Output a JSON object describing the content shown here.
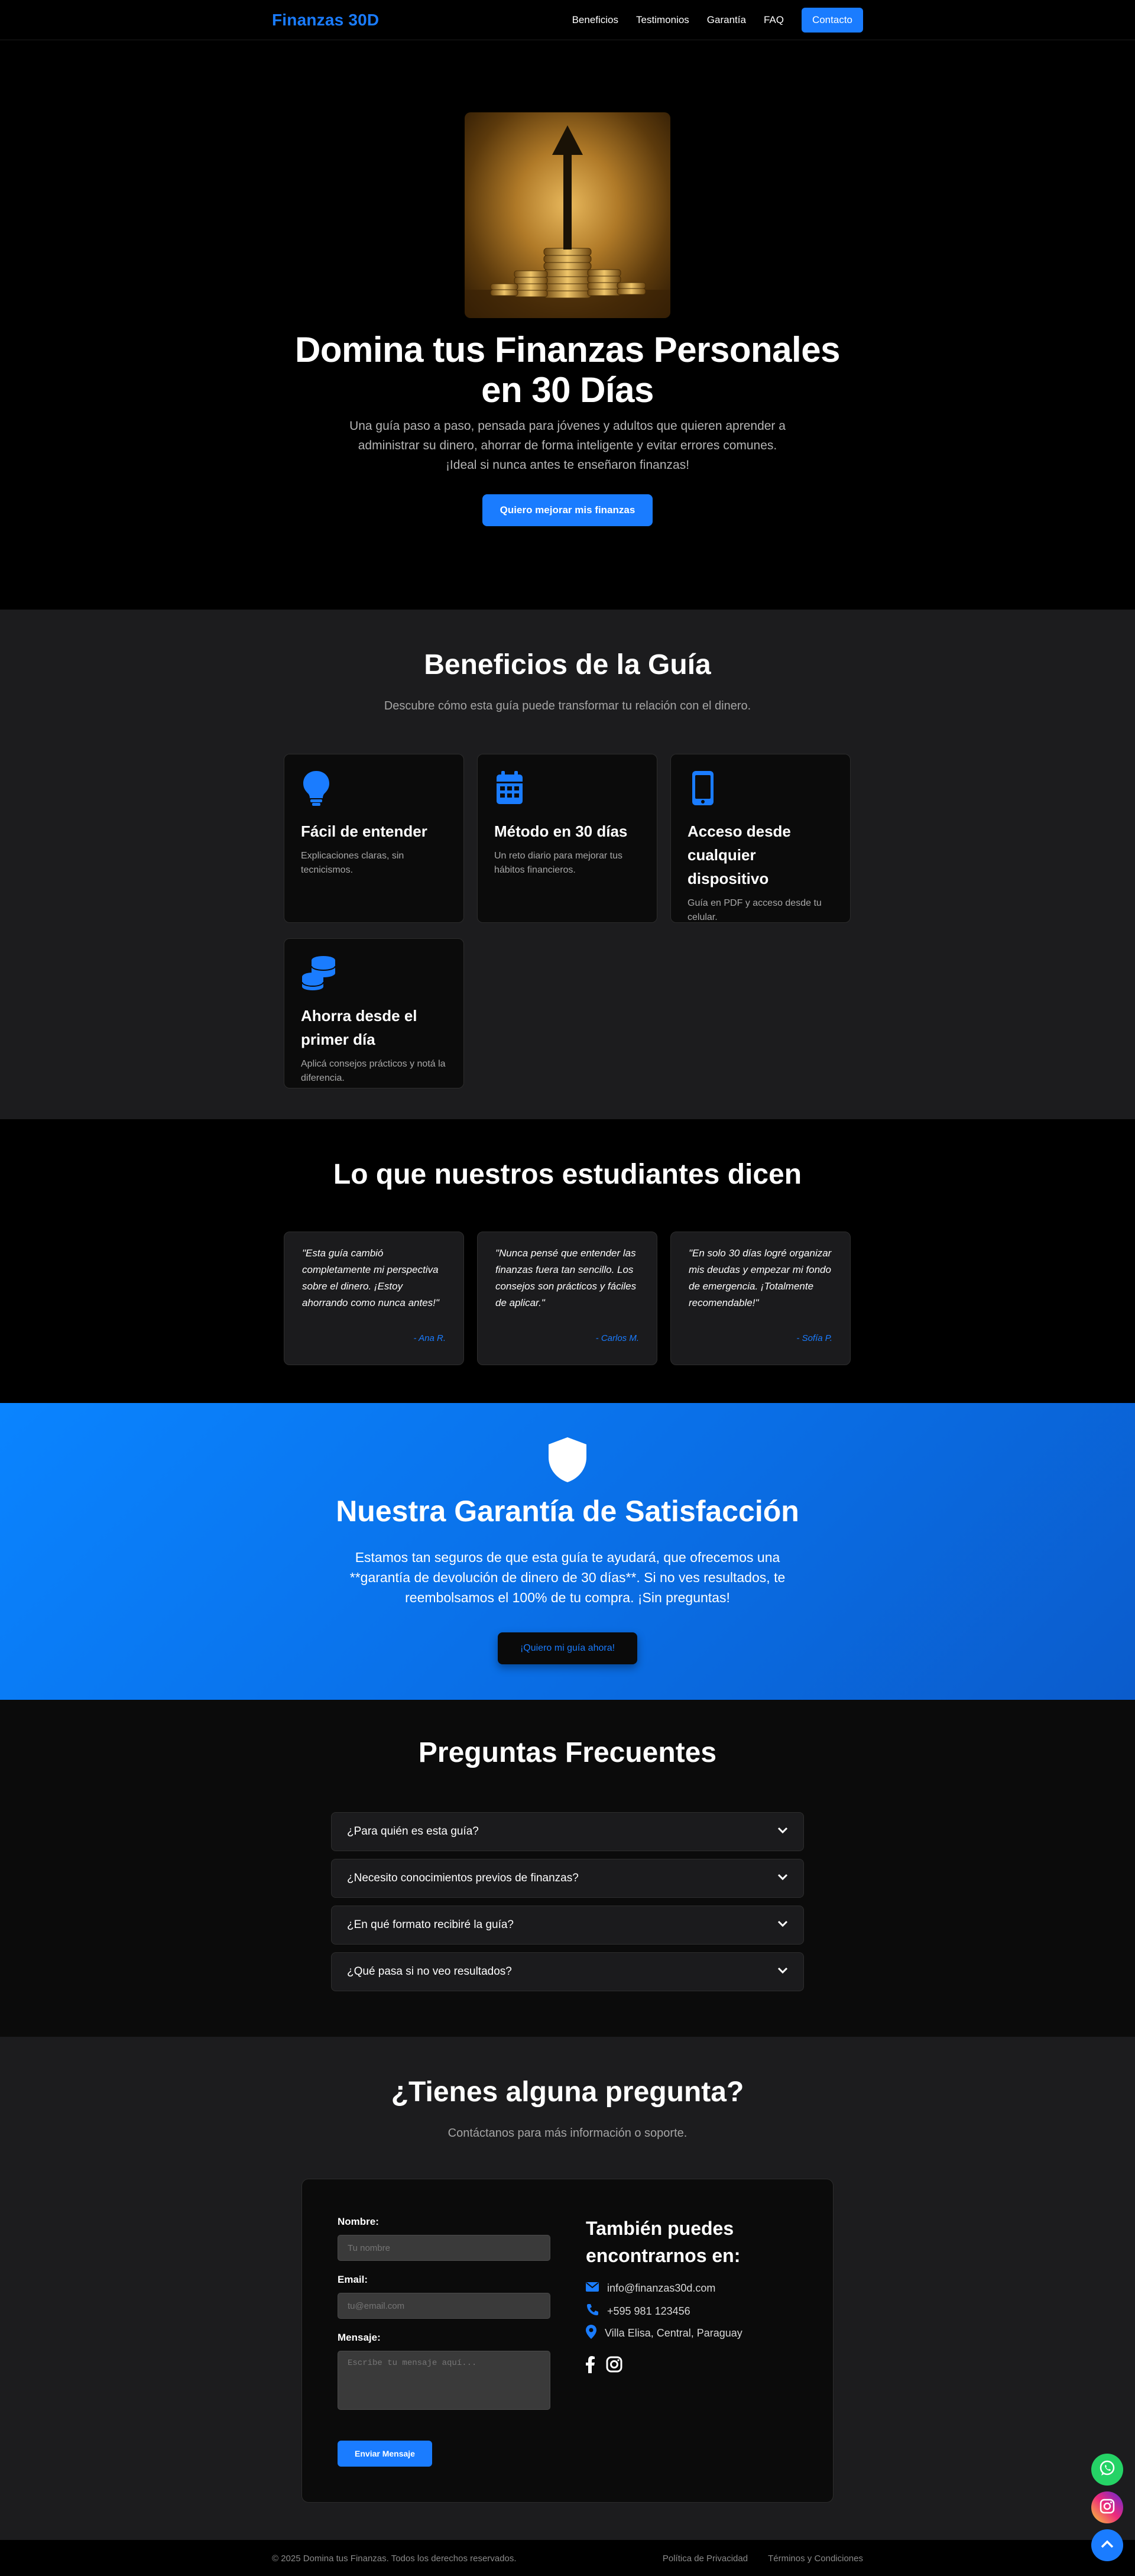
{
  "nav": {
    "brand": "Finanzas 30D",
    "links": [
      "Beneficios",
      "Testimonios",
      "Garantía",
      "FAQ"
    ],
    "cta": "Contacto"
  },
  "hero": {
    "title": "Domina tus Finanzas Personales en 30 Días",
    "subtitle": "Una guía paso a paso, pensada para jóvenes y adultos que quieren aprender a administrar su dinero, ahorrar de forma inteligente y evitar errores comunes. ¡Ideal si nunca antes te enseñaron finanzas!",
    "button": "Quiero mejorar mis finanzas"
  },
  "benefits": {
    "title": "Beneficios de la Guía",
    "subtitle": "Descubre cómo esta guía puede transformar tu relación con el dinero.",
    "cards": [
      {
        "icon": "lightbulb-icon",
        "title": "Fácil de entender",
        "text": "Explicaciones claras, sin tecnicismos."
      },
      {
        "icon": "calendar-icon",
        "title": "Método en 30 días",
        "text": "Un reto diario para mejorar tus hábitos financieros."
      },
      {
        "icon": "mobile-icon",
        "title": "Acceso desde cualquier dispositivo",
        "text": "Guía en PDF y acceso desde tu celular."
      },
      {
        "icon": "coins-icon",
        "title": "Ahorra desde el primer día",
        "text": "Aplicá consejos prácticos y notá la diferencia."
      }
    ]
  },
  "testimonials": {
    "title": "Lo que nuestros estudiantes dicen",
    "items": [
      {
        "quote": "\"Esta guía cambió completamente mi perspectiva sobre el dinero. ¡Estoy ahorrando como nunca antes!\"",
        "author": "- Ana R."
      },
      {
        "quote": "\"Nunca pensé que entender las finanzas fuera tan sencillo. Los consejos son prácticos y fáciles de aplicar.\"",
        "author": "- Carlos M."
      },
      {
        "quote": "\"En solo 30 días logré organizar mis deudas y empezar mi fondo de emergencia. ¡Totalmente recomendable!\"",
        "author": "- Sofía P."
      }
    ]
  },
  "guarantee": {
    "title": "Nuestra Garantía de Satisfacción",
    "text": "Estamos tan seguros de que esta guía te ayudará, que ofrecemos una **garantía de devolución de dinero de 30 días**. Si no ves resultados, te reembolsamos el 100% de tu compra. ¡Sin preguntas!",
    "button": "¡Quiero mi guía ahora!"
  },
  "faq": {
    "title": "Preguntas Frecuentes",
    "items": [
      "¿Para quién es esta guía?",
      "¿Necesito conocimientos previos de finanzas?",
      "¿En qué formato recibiré la guía?",
      "¿Qué pasa si no veo resultados?"
    ]
  },
  "contact": {
    "title": "¿Tienes alguna pregunta?",
    "subtitle": "Contáctanos para más información o soporte.",
    "name_label": "Nombre:",
    "name_placeholder": "Tu nombre",
    "email_label": "Email:",
    "email_placeholder": "tu@email.com",
    "message_label": "Mensaje:",
    "message_placeholder": "Escribe tu mensaje aquí...",
    "send": "Enviar Mensaje",
    "alt_title": "También puedes encontrarnos en:",
    "email": "info@finanzas30d.com",
    "phone": "+595 981 123456",
    "location": "Villa Elisa, Central, Paraguay"
  },
  "footer": {
    "copyright": "© 2025 Domina tus Finanzas. Todos los derechos reservados.",
    "privacy": "Política de Privacidad",
    "terms": "Términos y Condiciones"
  },
  "colors": {
    "accent": "#1a7cff",
    "background": "#0a0a0a",
    "section_alt": "#1c1c1e"
  }
}
